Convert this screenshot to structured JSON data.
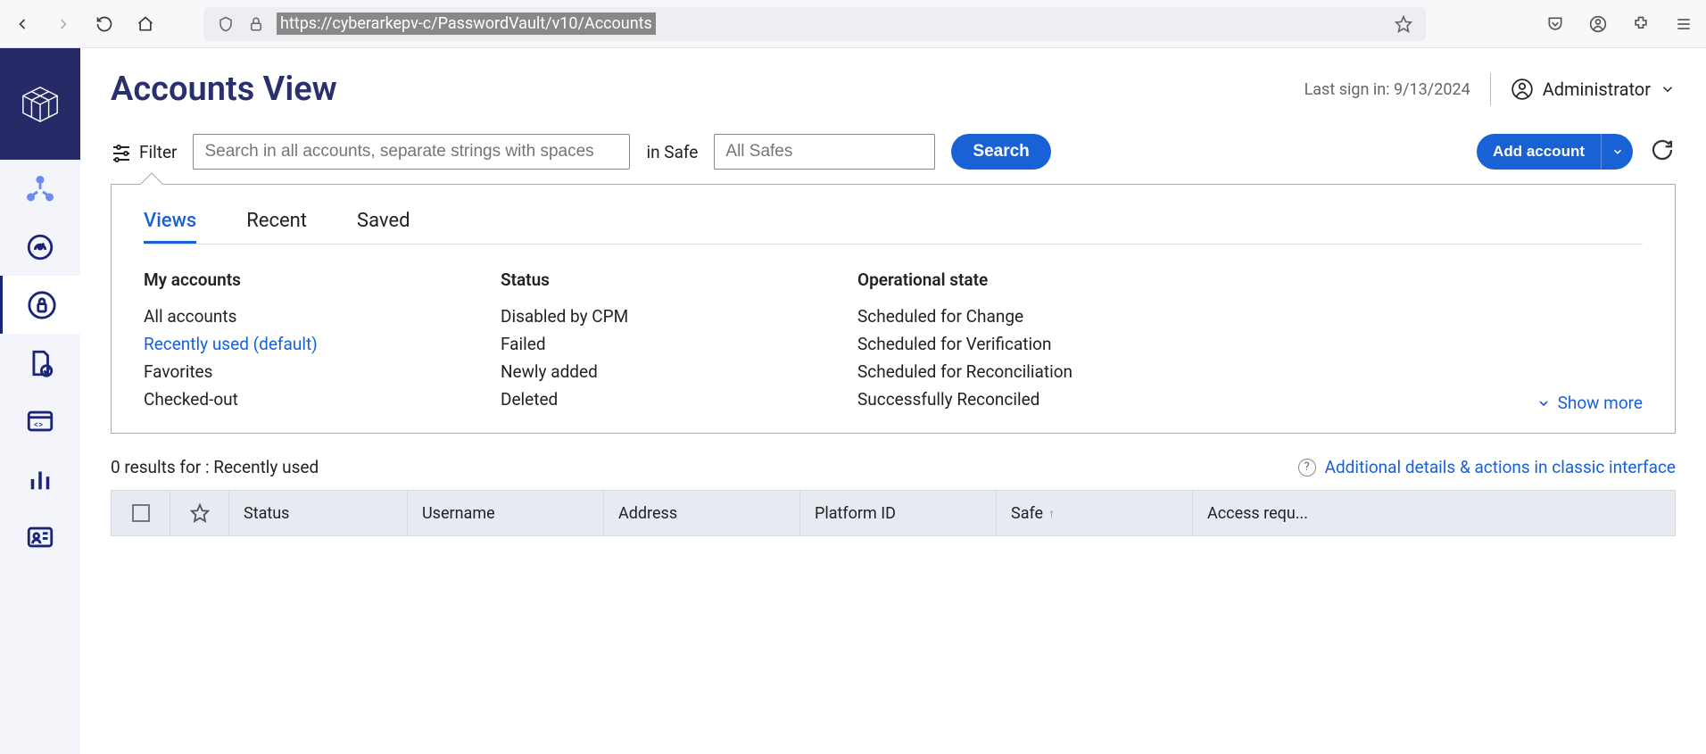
{
  "browser": {
    "url": "https://cyberarkepv-c/PasswordVault/v10/Accounts"
  },
  "header": {
    "title": "Accounts View",
    "last_sign_in": "Last sign in: 9/13/2024",
    "user": "Administrator"
  },
  "toolbar": {
    "filter_label": "Filter",
    "search_placeholder": "Search in all accounts, separate strings with spaces",
    "in_safe_label": "in Safe",
    "safe_placeholder": "All Safes",
    "search_button": "Search",
    "add_button": "Add account"
  },
  "filter_panel": {
    "tabs": [
      "Views",
      "Recent",
      "Saved"
    ],
    "columns": [
      {
        "title": "My accounts",
        "items": [
          "All accounts",
          "Recently used (default)",
          "Favorites",
          "Checked-out"
        ],
        "selected_index": 1
      },
      {
        "title": "Status",
        "items": [
          "Disabled by CPM",
          "Failed",
          "Newly added",
          "Deleted"
        ],
        "selected_index": -1
      },
      {
        "title": "Operational state",
        "items": [
          "Scheduled for Change",
          "Scheduled for Verification",
          "Scheduled for Reconciliation",
          "Successfully Reconciled"
        ],
        "selected_index": -1
      }
    ],
    "show_more": "Show more"
  },
  "results": {
    "summary": "0 results  for : Recently used",
    "classic_link": "Additional details & actions in classic interface"
  },
  "table": {
    "columns": [
      "Status",
      "Username",
      "Address",
      "Platform ID",
      "Safe",
      "Access requ..."
    ]
  }
}
